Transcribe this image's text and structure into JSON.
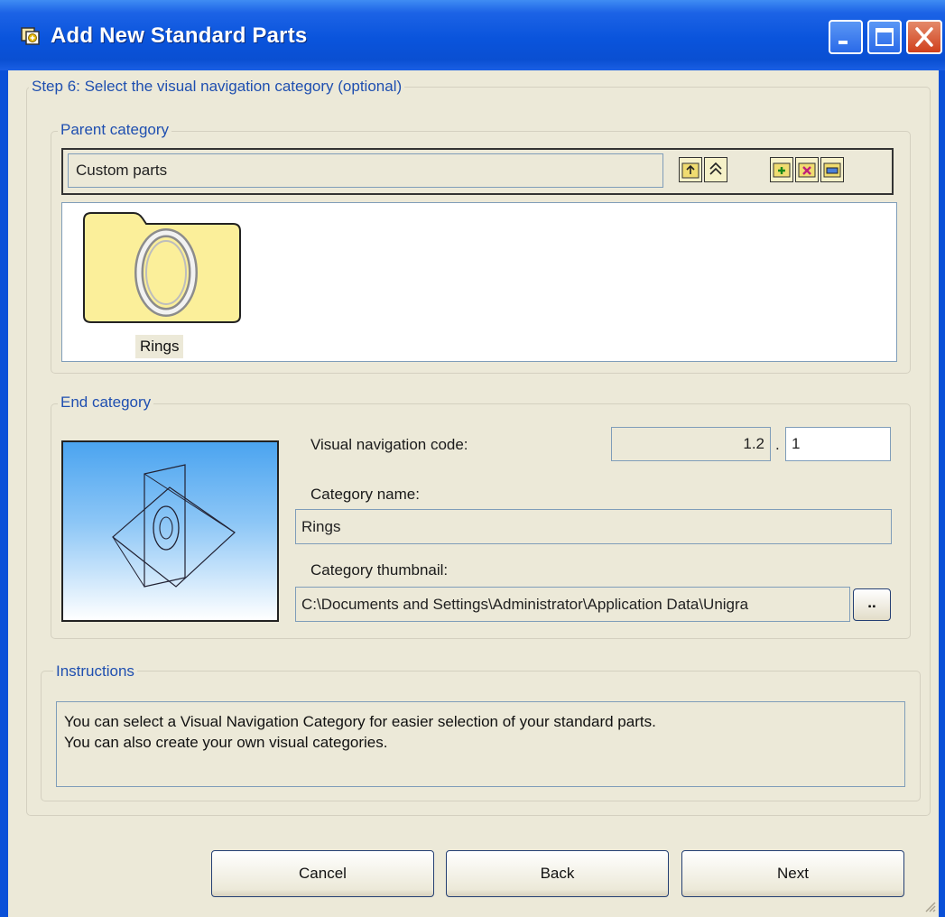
{
  "window": {
    "title": "Add New Standard Parts"
  },
  "step": {
    "title": "Step 6: Select the visual navigation category (optional)"
  },
  "parent": {
    "legend": "Parent category",
    "current": "Custom parts",
    "toolbar_icons": [
      "folder-up-icon",
      "go-to-top-icon",
      "add-folder-icon",
      "delete-folder-icon",
      "edit-folder-icon"
    ],
    "items": [
      {
        "label": "Rings"
      }
    ]
  },
  "end": {
    "legend": "End category",
    "code_label": "Visual navigation code:",
    "code_prefix": "1.2",
    "code_sep": ".",
    "code_value": "1",
    "name_label": "Category name:",
    "name_value": "Rings",
    "thumb_label": "Category thumbnail:",
    "thumb_value": "C:\\Documents and Settings\\Administrator\\Application Data\\Unigra",
    "browse_label": ".."
  },
  "instructions": {
    "legend": "Instructions",
    "lines": [
      "You can select a Visual Navigation Category for easier selection of your standard parts.",
      "You can also create your own visual categories."
    ]
  },
  "buttons": {
    "cancel": "Cancel",
    "back": "Back",
    "next": "Next"
  },
  "colors": {
    "titlebar": "#0a54dc",
    "dialog_bg": "#ece9d8",
    "legend_text": "#1f4fb0",
    "close_button": "#d0401c"
  }
}
